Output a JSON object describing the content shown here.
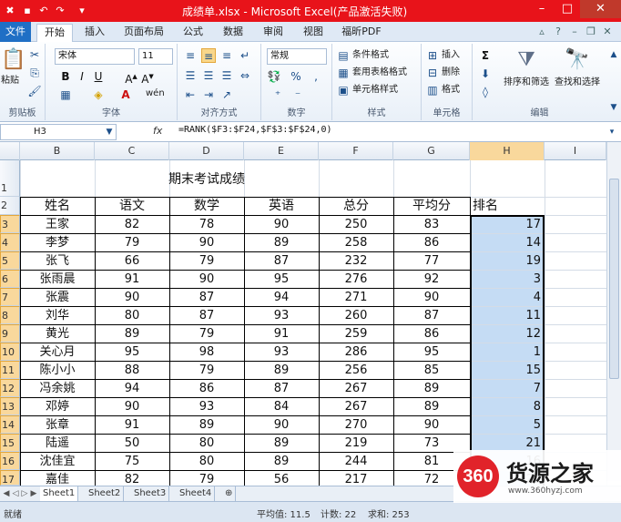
{
  "window": {
    "title": "成绩单.xlsx - Microsoft Excel(产品激活失败)",
    "min": "–",
    "max": "□",
    "close": "✕"
  },
  "menu": {
    "tabs": [
      "文件",
      "开始",
      "插入",
      "页面布局",
      "公式",
      "数据",
      "审阅",
      "视图",
      "福昕PDF"
    ]
  },
  "ribbon": {
    "clipboard": {
      "paste": "粘贴",
      "label": "剪贴板"
    },
    "font": {
      "name": "宋体",
      "size": "11",
      "bold": "B",
      "italic": "I",
      "underline": "U",
      "wen": "wén",
      "label": "字体"
    },
    "align": {
      "label": "对齐方式"
    },
    "number": {
      "format": "常规",
      "label": "数字"
    },
    "styles": {
      "cond": "条件格式",
      "table": "套用表格格式",
      "cell": "单元格样式",
      "label": "样式"
    },
    "cells": {
      "insert": "插入",
      "delete": "删除",
      "format": "格式",
      "label": "单元格"
    },
    "edit": {
      "sort": "排序和筛选",
      "find": "查找和选择",
      "label": "编辑"
    }
  },
  "formula_bar": {
    "name_box": "H3",
    "fx": "fx",
    "formula": "=RANK($F3:$F24,$F$3:$F$24,0)"
  },
  "columns": [
    "B",
    "C",
    "D",
    "E",
    "F",
    "G",
    "H",
    "I"
  ],
  "rows": [
    "1",
    "2",
    "3",
    "4",
    "5",
    "6",
    "7",
    "8",
    "9",
    "10",
    "11",
    "12",
    "13",
    "14",
    "15",
    "16",
    "17"
  ],
  "sheet": {
    "title": "期末考试成绩",
    "headers": [
      "姓名",
      "语文",
      "数学",
      "英语",
      "总分",
      "平均分",
      "排名"
    ],
    "data": [
      [
        "王家",
        "82",
        "78",
        "90",
        "250",
        "83",
        "17"
      ],
      [
        "李梦",
        "79",
        "90",
        "89",
        "258",
        "86",
        "14"
      ],
      [
        "张飞",
        "66",
        "79",
        "87",
        "232",
        "77",
        "19"
      ],
      [
        "张雨晨",
        "91",
        "90",
        "95",
        "276",
        "92",
        "3"
      ],
      [
        "张震",
        "90",
        "87",
        "94",
        "271",
        "90",
        "4"
      ],
      [
        "刘华",
        "80",
        "87",
        "93",
        "260",
        "87",
        "11"
      ],
      [
        "黄光",
        "89",
        "79",
        "91",
        "259",
        "86",
        "12"
      ],
      [
        "关心月",
        "95",
        "98",
        "93",
        "286",
        "95",
        "1"
      ],
      [
        "陈小小",
        "88",
        "79",
        "89",
        "256",
        "85",
        "15"
      ],
      [
        "冯余姚",
        "94",
        "86",
        "87",
        "267",
        "89",
        "7"
      ],
      [
        "邓婷",
        "90",
        "93",
        "84",
        "267",
        "89",
        "8"
      ],
      [
        "张章",
        "91",
        "89",
        "90",
        "270",
        "90",
        "5"
      ],
      [
        "陆遥",
        "50",
        "80",
        "89",
        "219",
        "73",
        "21"
      ],
      [
        "沈佳宜",
        "75",
        "80",
        "89",
        "244",
        "81",
        "16"
      ],
      [
        "嘉佳",
        "82",
        "79",
        "56",
        "217",
        "72",
        "22"
      ]
    ]
  },
  "sheet_tabs": [
    "Sheet1",
    "Sheet2",
    "Sheet3",
    "Sheet4"
  ],
  "status": {
    "mode": "就绪",
    "average": "平均值: 11.5",
    "count": "计数: 22",
    "sum": "求和: 253"
  },
  "watermark": {
    "logo": "360",
    "name": "货源之家",
    "url": "www.360hyzj.com"
  }
}
